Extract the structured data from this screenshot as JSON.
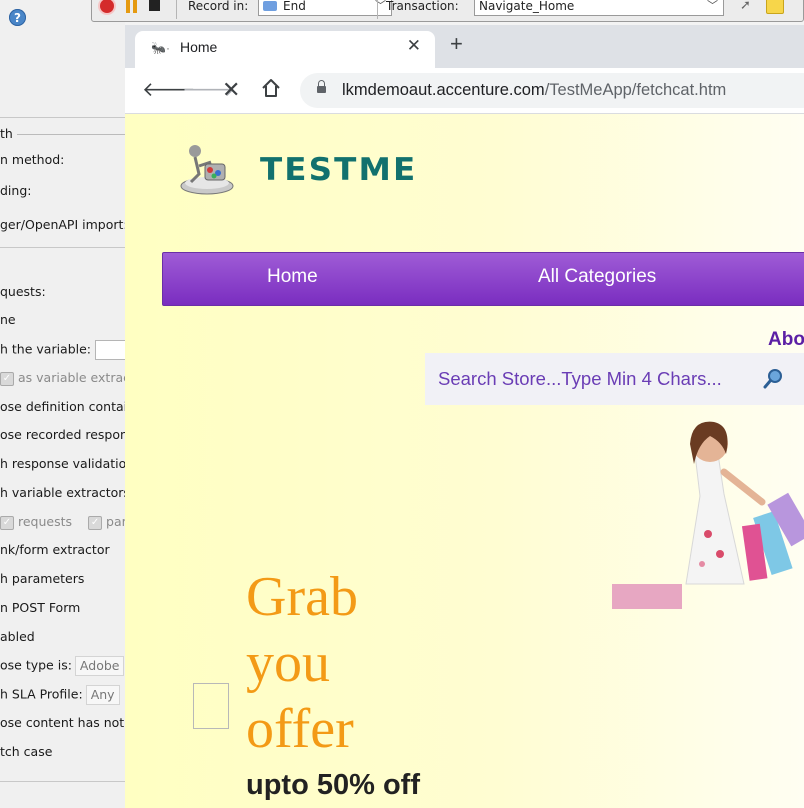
{
  "left_panel": {
    "rows": [
      "th",
      "n method:",
      "ding:",
      "ger/OpenAPI import:",
      "quests:",
      "ne",
      "h the variable:",
      "as variable extract",
      "ose definition contair",
      "ose recorded respons",
      "h response validation",
      "h variable extractors",
      "requests",
      "para",
      "nk/form extractor",
      "h parameters",
      "n POST Form",
      "abled",
      "ose type is:",
      "h SLA Profile:",
      "ose content has not b",
      "tch case"
    ],
    "content_type_value": "Adobe",
    "sla_profile_value": "Any"
  },
  "toolbar": {
    "record_in_label": "Record in:",
    "record_in_value": "End",
    "transaction_label": "Transaction:",
    "transaction_value": "Navigate_Home"
  },
  "browser": {
    "tab_title": "Home",
    "url_host": "lkmdemoaut.accenture.com",
    "url_path": "/TestMeApp/fetchcat.htm"
  },
  "page": {
    "logo_text": "TESTME",
    "menu": [
      "Home",
      "All Categories"
    ],
    "about_link": "Abo",
    "search_placeholder": "Search Store...Type Min 4 Chars...",
    "promo_heading": "Grab you offer",
    "promo_sub": "upto 50% off"
  },
  "colors": {
    "menu_purple": "#8a3fcb",
    "promo_orange": "#f39a16",
    "logo_teal": "#12716e"
  }
}
